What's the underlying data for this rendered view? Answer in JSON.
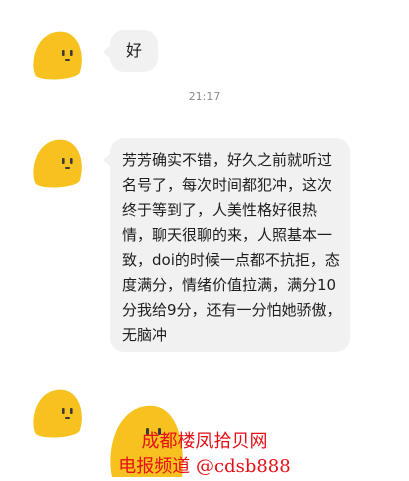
{
  "chat": {
    "messages": [
      {
        "text": "好"
      },
      {
        "text": "芳芳确实不错，好久之前就听过名号了，每次时间都犯冲，这次终于等到了，人美性格好很热情，聊天很聊的来，人照基本一致，doi的时候一点都不抗拒，态度满分，情绪价值拉满，满分10分我给9分，还有一分怕她骄傲，无脑冲"
      }
    ],
    "timestamp": "21:17"
  },
  "watermark": {
    "line1": "成都楼凤拾贝网",
    "line2": "电报频道 @cdsb888"
  },
  "colors": {
    "avatar": "#f7c21f",
    "bubble": "#f1f1f1",
    "watermark": "#e50f16"
  }
}
